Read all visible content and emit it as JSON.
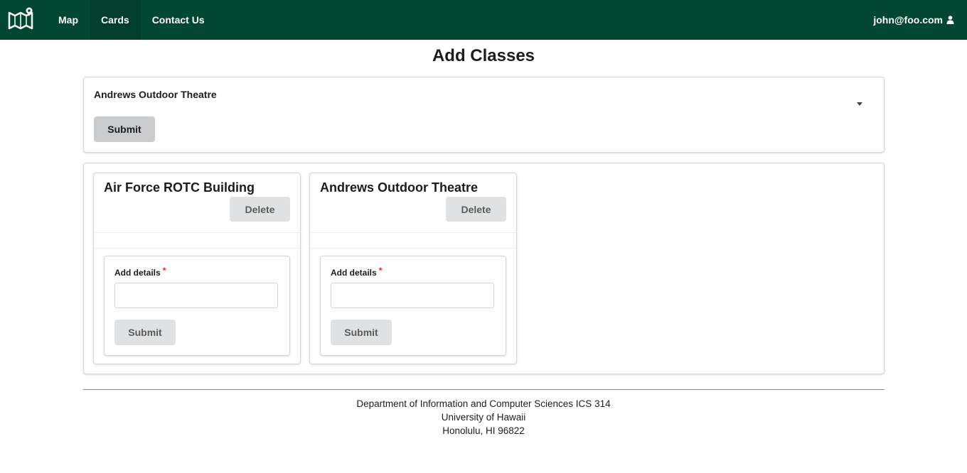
{
  "nav": {
    "logo_icon": "campus-map-logo-icon",
    "items": [
      {
        "label": "Map",
        "active": false
      },
      {
        "label": "Cards",
        "active": true
      },
      {
        "label": "Contact Us",
        "active": false
      }
    ],
    "user": {
      "email": "john@foo.com",
      "icon": "user-icon"
    }
  },
  "page": {
    "title": "Add Classes"
  },
  "add_form": {
    "selected_location": "Andrews Outdoor Theatre",
    "submit_label": "Submit"
  },
  "cards": [
    {
      "title": "Air Force ROTC Building",
      "delete_label": "Delete",
      "field_label": "Add details",
      "required_mark": "*",
      "field_value": "",
      "submit_label": "Submit"
    },
    {
      "title": "Andrews Outdoor Theatre",
      "delete_label": "Delete",
      "field_label": "Add details",
      "required_mark": "*",
      "field_value": "",
      "submit_label": "Submit"
    }
  ],
  "footer": {
    "line1": "Department of Information and Computer Sciences ICS 314",
    "line2": "University of Hawaii",
    "line3": "Honolulu, HI 96822"
  },
  "colors": {
    "navbar": "#024731",
    "required": "#db2828"
  }
}
